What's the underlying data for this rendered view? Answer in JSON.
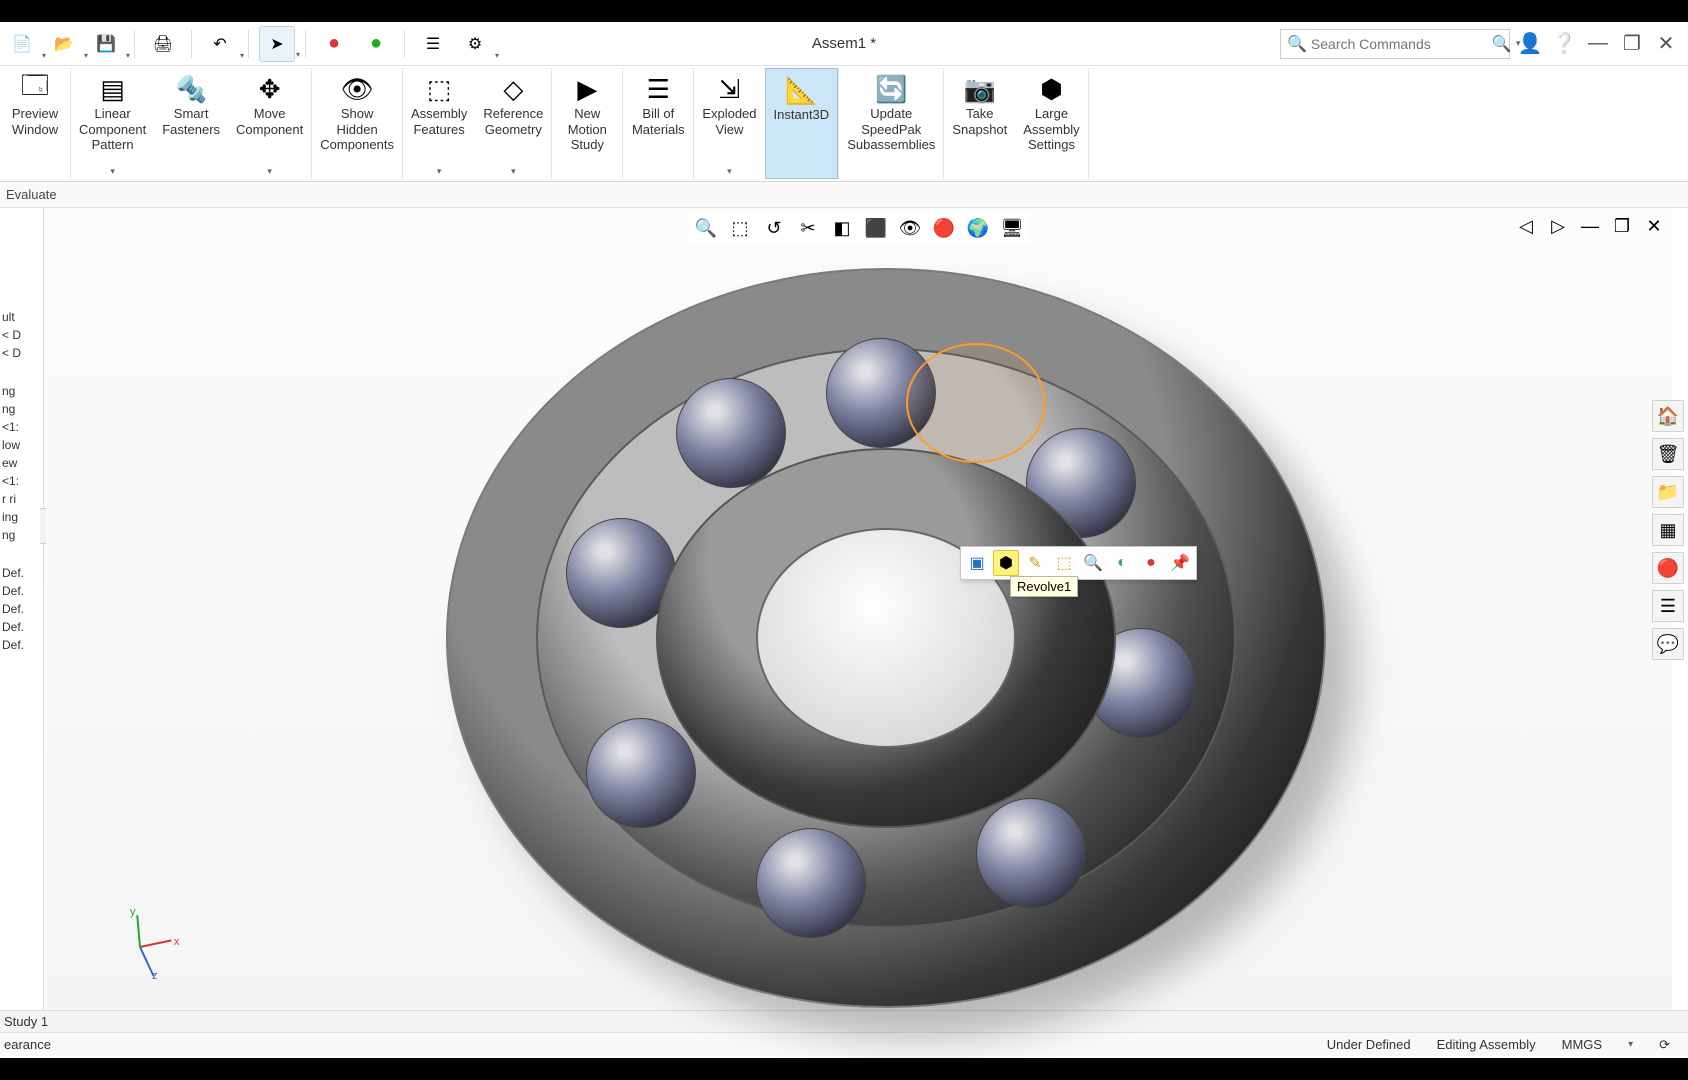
{
  "title": "Assem1 *",
  "search_placeholder": "Search Commands",
  "tab": "Evaluate",
  "qat": {
    "new": "New",
    "open": "Open",
    "save": "Save",
    "print": "Print",
    "undo": "Undo",
    "select": "Select",
    "rebuild_red": "●",
    "rebuild_grn": "●",
    "options": "Options",
    "settings": "Settings"
  },
  "ribbon": [
    {
      "key": "PreviewWindow",
      "label": "Preview\nWindow",
      "dd": false
    },
    {
      "key": "LinearPattern",
      "label": "Linear\nComponent\nPattern",
      "dd": true
    },
    {
      "key": "SmartFasteners",
      "label": "Smart\nFasteners",
      "dd": false
    },
    {
      "key": "MoveComponent",
      "label": "Move\nComponent",
      "dd": true
    },
    {
      "key": "ShowHidden",
      "label": "Show\nHidden\nComponents",
      "dd": false
    },
    {
      "key": "AssemblyFeatures",
      "label": "Assembly\nFeatures",
      "dd": true
    },
    {
      "key": "ReferenceGeometry",
      "label": "Reference\nGeometry",
      "dd": true
    },
    {
      "key": "NewMotionStudy",
      "label": "New\nMotion\nStudy",
      "dd": false
    },
    {
      "key": "BillOfMaterials",
      "label": "Bill of\nMaterials",
      "dd": false
    },
    {
      "key": "ExplodedView",
      "label": "Exploded\nView",
      "dd": true
    },
    {
      "key": "Instant3D",
      "label": "Instant3D",
      "dd": false,
      "active": true
    },
    {
      "key": "UpdateSpeedPak",
      "label": "Update\nSpeedPak\nSubassemblies",
      "dd": false
    },
    {
      "key": "TakeSnapshot",
      "label": "Take\nSnapshot",
      "dd": false
    },
    {
      "key": "LargeAssembly",
      "label": "Large\nAssembly\nSettings",
      "dd": false
    }
  ],
  "view_toolbar": [
    "zoom-fit",
    "zoom-area",
    "prev-view",
    "section",
    "display-style",
    "view-orient",
    "hide-show",
    "appearance",
    "scene",
    "view-settings"
  ],
  "context": {
    "tooltip": "Revolve1",
    "buttons": [
      "select-other",
      "isolate",
      "edit-feature",
      "hide-show",
      "zoom-sel",
      "normal-to",
      "appearance",
      "pin"
    ]
  },
  "tree": [
    "ult",
    "< D",
    "< D",
    "ng",
    "ng",
    "<1:",
    "low",
    "ew",
    "<1:",
    "r ri",
    "ing",
    "ng",
    "Def.",
    "Def.",
    "Def.",
    "Def.",
    "Def."
  ],
  "triad": {
    "x": "x",
    "y": "y",
    "z": "z"
  },
  "bottom_tab": "Study 1",
  "status": {
    "left": "earance",
    "def": "Under Defined",
    "mode": "Editing Assembly",
    "units": "MMGS"
  },
  "taskpane": [
    "home",
    "resources",
    "file-explorer",
    "view-palette",
    "appearances",
    "custom-props",
    "forum"
  ],
  "icons": {
    "new": "📄",
    "open": "📂",
    "save": "💾",
    "print": "🖨",
    "undo": "↶",
    "select": "➤",
    "options": "☰",
    "settings": "⚙",
    "search": "🔍",
    "user": "👤",
    "help": "❔",
    "min": "—",
    "max": "❐",
    "close": "✕",
    "home": "🏠",
    "resources": "🗑",
    "file-explorer": "📁",
    "view-palette": "▦",
    "appearances": "🔴",
    "custom-props": "☰",
    "forum": "💬"
  }
}
